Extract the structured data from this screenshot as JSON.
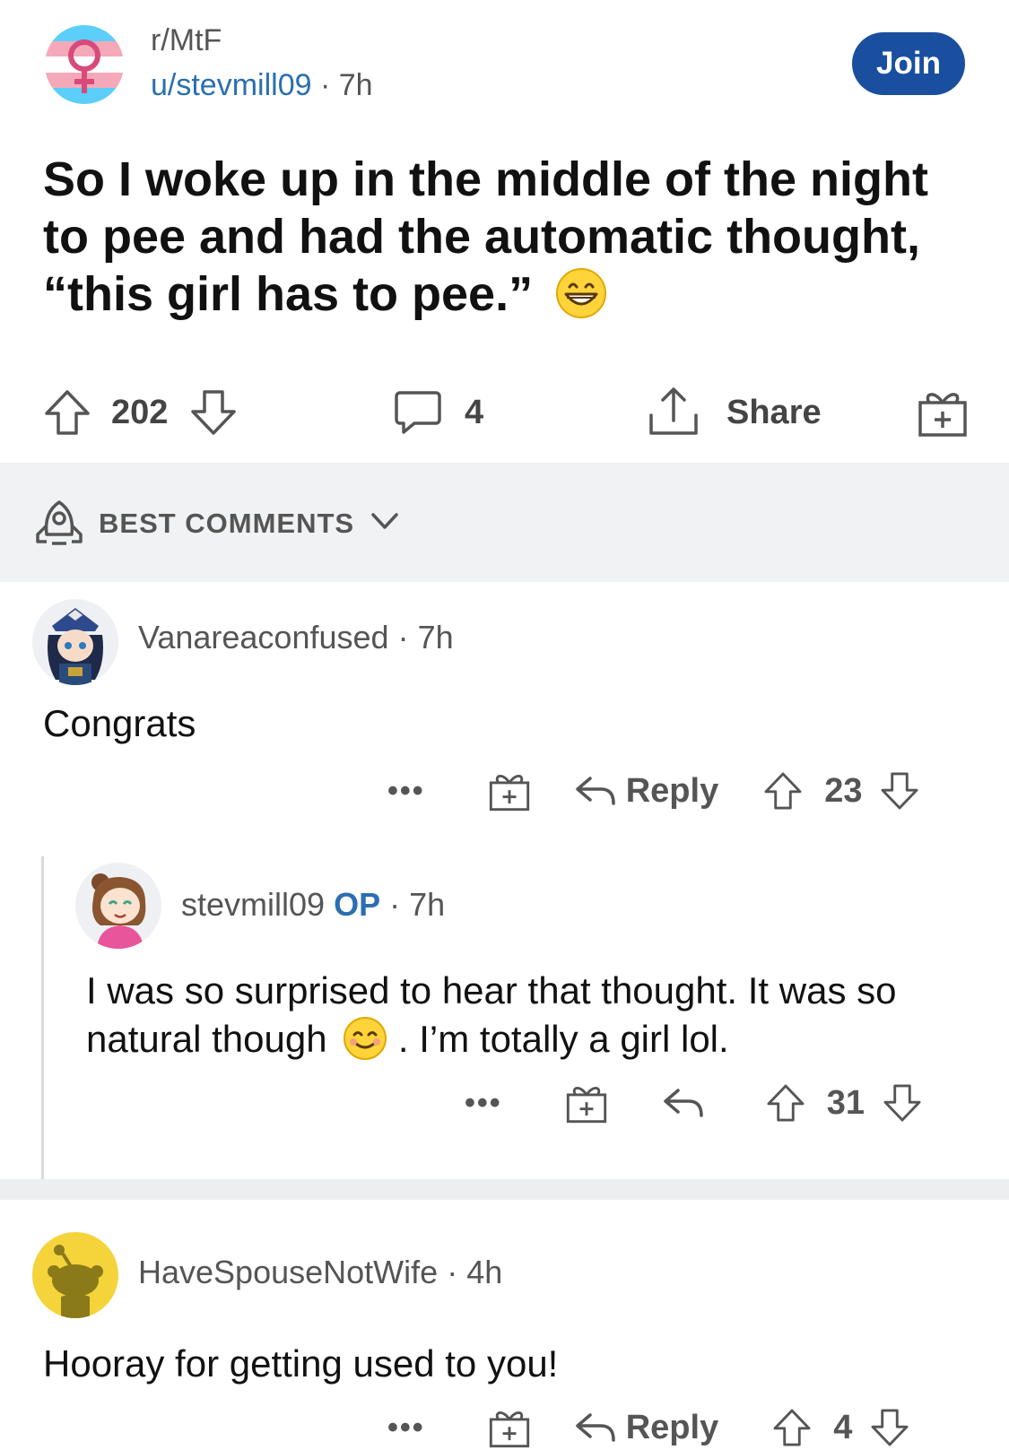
{
  "post": {
    "subreddit": "r/MtF",
    "username": "u/stevmill09",
    "separator": "·",
    "age": "7h",
    "join_label": "Join",
    "title": "So I woke up in the middle of the night to pee and had the automatic thought, “this girl has to pee.”",
    "title_emoji": "grinning-face-emoji",
    "upvotes": "202",
    "comments": "4",
    "share_label": "Share"
  },
  "sort": {
    "label": "BEST COMMENTS"
  },
  "comments": [
    {
      "username": "Vanareaconfused",
      "age": "7h",
      "body": "Congrats",
      "reply_label": "Reply",
      "votes": "23"
    },
    {
      "username": "stevmill09",
      "op_badge": "OP",
      "age": "7h",
      "body_part1": "I was so surprised to hear that thought. It was so natural though",
      "body_emoji": "smiling-face-emoji",
      "body_part2": ".  I’m totally a girl lol.",
      "votes": "31"
    },
    {
      "username": "HaveSpouseNotWife",
      "age": "4h",
      "body": "Hooray for getting used to you!",
      "reply_label": "Reply",
      "votes": "4"
    }
  ],
  "colors": {
    "join": "#1a4fa0",
    "username_link": "#2a6fb0",
    "sort_bar": "#f1f2f4"
  }
}
